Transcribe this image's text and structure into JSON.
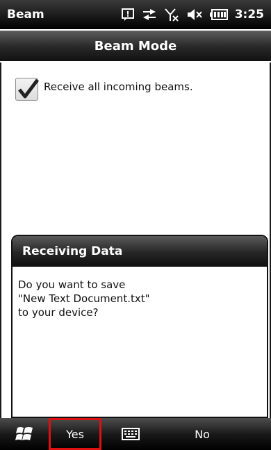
{
  "status_bar": {
    "title": "Beam",
    "time": "3:25",
    "icons": [
      "notification-icon",
      "data-sync-icon",
      "no-signal-icon",
      "speaker-muted-icon",
      "battery-icon"
    ]
  },
  "header": {
    "title": "Beam Mode"
  },
  "content": {
    "checkbox": {
      "label": "Receive all incoming beams.",
      "checked": true
    }
  },
  "dialog": {
    "title": "Receiving Data",
    "lines": [
      "Do you want to save",
      "\"New Text Document.txt\"",
      "to your device?"
    ]
  },
  "softkeys": {
    "left": "Yes",
    "right": "No",
    "highlight_color": "#e01010"
  }
}
